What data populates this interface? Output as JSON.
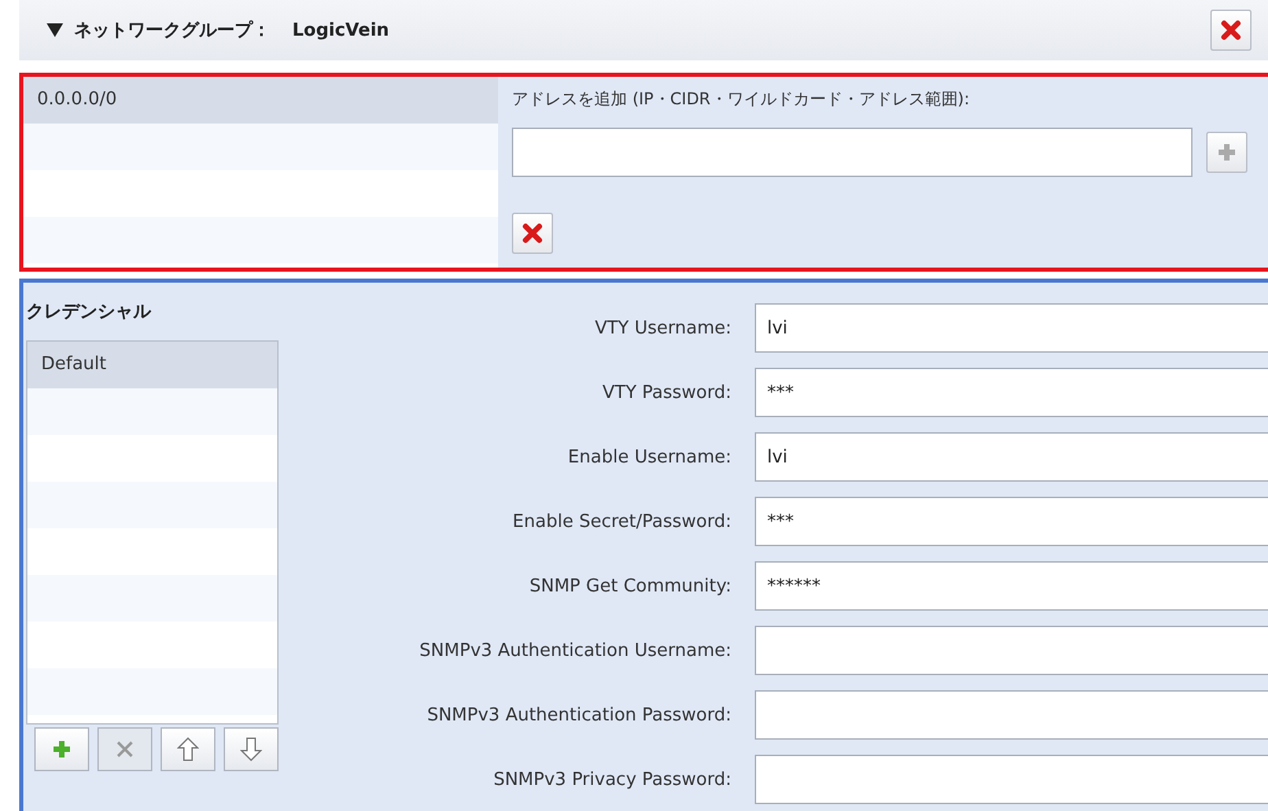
{
  "group": {
    "expanded": true,
    "label": "ネットワークグループ：",
    "name": "LogicVein"
  },
  "addresses": {
    "items": [
      {
        "text": "0.0.0.0/0",
        "selected": true
      }
    ],
    "add_label": "アドレスを追加 (IP・CIDR・ワイルドカード・アドレス範囲):"
  },
  "credentials": {
    "title": "クレデンシャル",
    "items": [
      {
        "text": "Default",
        "selected": true
      }
    ],
    "buttons": [
      {
        "kind": "add",
        "disabled": false
      },
      {
        "kind": "delete",
        "disabled": true
      },
      {
        "kind": "up",
        "disabled": false
      },
      {
        "kind": "down",
        "disabled": false
      }
    ]
  },
  "fields": [
    {
      "label": "VTY Username:",
      "value": "lvi"
    },
    {
      "label": "VTY Password:",
      "value": "***"
    },
    {
      "label": "Enable Username:",
      "value": "lvi"
    },
    {
      "label": "Enable Secret/Password:",
      "value": "***"
    },
    {
      "label": "SNMP Get Community:",
      "value": "******"
    },
    {
      "label": "SNMPv3 Authentication Username:"
    },
    {
      "label": "SNMPv3 Authentication Password:"
    },
    {
      "label": "SNMPv3 Privacy Password:"
    }
  ]
}
